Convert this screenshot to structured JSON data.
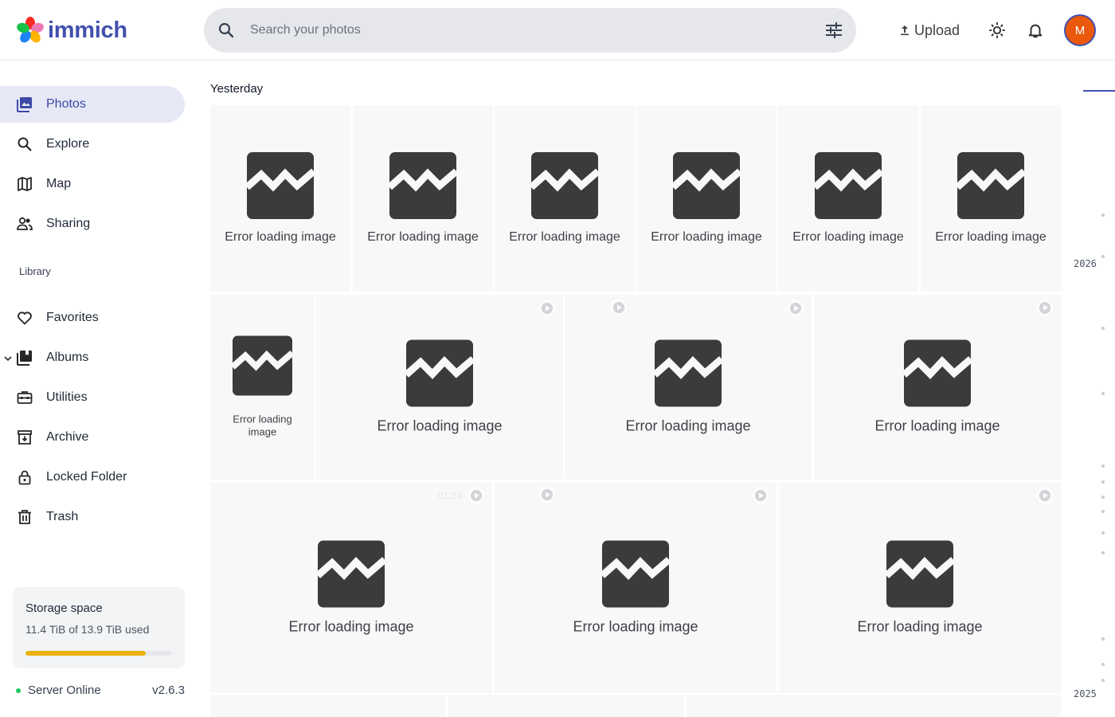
{
  "app": {
    "name": "immich"
  },
  "search": {
    "placeholder": "Search your photos"
  },
  "header": {
    "upload_label": "Upload",
    "avatar_initial": "M"
  },
  "sidebar": {
    "items": [
      {
        "label": "Photos",
        "icon": "photos-icon",
        "active": true
      },
      {
        "label": "Explore",
        "icon": "magnify-icon"
      },
      {
        "label": "Map",
        "icon": "map-icon"
      },
      {
        "label": "Sharing",
        "icon": "people-icon"
      }
    ],
    "library_label": "Library",
    "library_items": [
      {
        "label": "Favorites",
        "icon": "heart-icon"
      },
      {
        "label": "Albums",
        "icon": "album-icon"
      },
      {
        "label": "Utilities",
        "icon": "toolbox-icon"
      },
      {
        "label": "Archive",
        "icon": "archive-icon"
      },
      {
        "label": "Locked Folder",
        "icon": "lock-icon"
      },
      {
        "label": "Trash",
        "icon": "trash-icon"
      }
    ]
  },
  "storage": {
    "title": "Storage space",
    "usage_text": "11.4 TiB of 13.9 TiB used",
    "used_fraction": 0.82,
    "bar_color": "#eab308"
  },
  "server": {
    "status": "Server Online",
    "version": "v2.6.3",
    "status_color": "#22c55e"
  },
  "timeline": {
    "date_group": "Yesterday",
    "error_text": "Error loading image",
    "tiles": [
      {
        "video": false,
        "duration": ""
      },
      {
        "video": false,
        "duration": ""
      },
      {
        "video": false,
        "duration": ""
      },
      {
        "video": false,
        "duration": ""
      },
      {
        "video": false,
        "duration": ""
      },
      {
        "video": false,
        "duration": ""
      },
      {
        "video": false,
        "duration": ""
      },
      {
        "video": true,
        "duration": ""
      },
      {
        "video": true,
        "duration": ""
      },
      {
        "video": true,
        "duration": ""
      },
      {
        "video": true,
        "duration": "01:24"
      },
      {
        "video": true,
        "duration": ""
      },
      {
        "video": true,
        "duration": ""
      }
    ]
  },
  "scrubber": {
    "years": [
      "2026",
      "2025"
    ],
    "accent": "#4250af"
  },
  "colors": {
    "brand": "#4250af",
    "active_nav_bg": "#e6e8f6",
    "avatar_bg": "#ea580c"
  }
}
